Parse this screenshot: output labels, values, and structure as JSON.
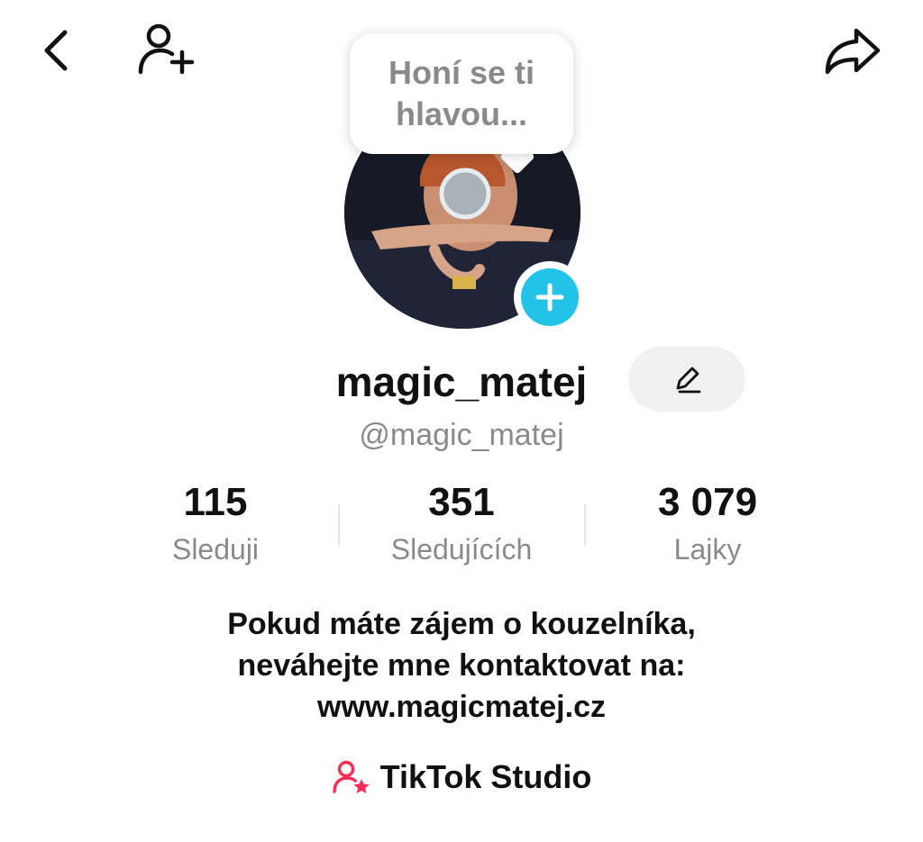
{
  "header": {
    "back_icon": "chevron-left-icon",
    "add_friend_icon": "user-plus-icon",
    "share_icon": "share-arrow-icon"
  },
  "profile": {
    "note_bubble": "Honí se ti hlavou...",
    "display_name": "magic_matej",
    "username": "@magic_matej",
    "edit_icon": "pencil-icon",
    "add_story_icon": "plus-icon",
    "accent_color": "#22c3e6"
  },
  "stats": [
    {
      "value": "115",
      "label": "Sleduji"
    },
    {
      "value": "351",
      "label": "Sledujících"
    },
    {
      "value": "3 079",
      "label": "Lajky"
    }
  ],
  "bio": {
    "lines": [
      "Pokud máte zájem o kouzelníka,",
      "neváhejte mne kontaktovat na:",
      "www.magicmatej.cz"
    ]
  },
  "studio": {
    "label": "TikTok Studio",
    "icon": "user-star-icon",
    "icon_color": "#fe2c55"
  }
}
